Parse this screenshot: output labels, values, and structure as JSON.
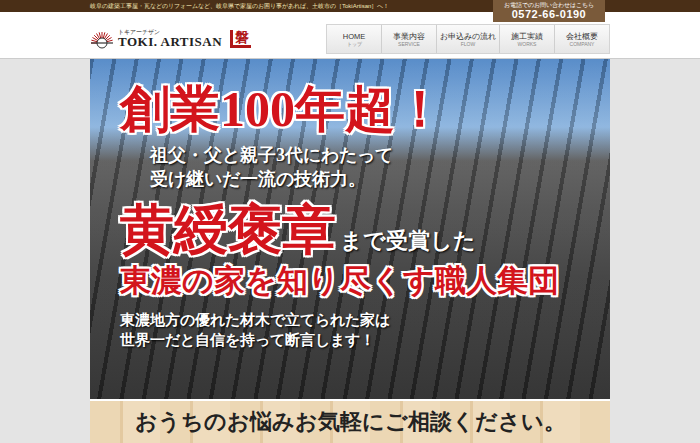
{
  "top_bar": {
    "tagline": "岐阜の建築工事屋・瓦などのリフォームなど、岐阜県で家屋のお困り事があれば、土岐市の［TokiArtisan］へ！",
    "contact_label": "お電話でのお問い合わせはこちら",
    "phone": "0572-66-0190"
  },
  "logo": {
    "kana": "トキアーチザン",
    "name": "TOKI. ARTISAN",
    "mark": "磐"
  },
  "nav": [
    {
      "label": "HOME",
      "sub": "トップ",
      "selected": false
    },
    {
      "label": "事業内容",
      "sub": "SERVICE",
      "selected": false
    },
    {
      "label": "お申込みの流れ",
      "sub": "FLOW",
      "selected": false
    },
    {
      "label": "施工実績",
      "sub": "WORKS",
      "selected": false
    },
    {
      "label": "会社概要",
      "sub": "COMPANY",
      "selected": false
    }
  ],
  "hero": {
    "headline": "創業100年超！",
    "lines": [
      "祖父・父と親子3代にわたって",
      "受け継いだ一流の技術力。"
    ],
    "award": "黄綬褒章",
    "award_suffix": "まで受賞した",
    "tagline": "東濃の家を知り尽くす職人集団",
    "closing": [
      "東濃地方の優れた材木で立てられた家は",
      "世界一だと自信を持って断言します！"
    ]
  },
  "banner": {
    "text": "おうちのお悩みお気軽にご相談ください。"
  }
}
